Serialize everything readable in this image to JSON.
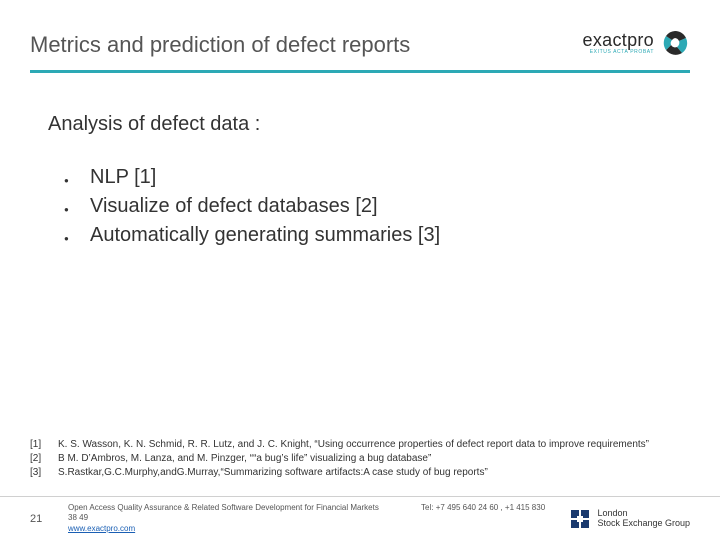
{
  "header": {
    "title": "Metrics and prediction of defect reports",
    "logo": {
      "main": "exactpro",
      "sub": "EXITUS ACTA PROBAT"
    }
  },
  "content": {
    "subtitle": "Analysis of defect data :",
    "bullets": [
      "NLP [1]",
      "Visualize of defect databases [2]",
      "Automatically generating summaries [3]"
    ]
  },
  "refs": [
    {
      "n": "[1]",
      "t": "K. S. Wasson, K. N. Schmid, R. R. Lutz, and J. C. Knight, “Using occurrence properties of defect report data to improve requirements”"
    },
    {
      "n": "[2]",
      "t": "B M. D’Ambros, M. Lanza, and M. Pinzger, ““a bug’s life” visualizing a bug database”"
    },
    {
      "n": "[3]",
      "t": " S.Rastkar,G.C.Murphy,andG.Murray,“Summarizing software artifacts:A case study of bug reports”"
    }
  ],
  "footer": {
    "page": "21",
    "line1": "Open Access Quality Assurance & Related Software Development for Financial Markets",
    "link": "www.exactpro.com",
    "tel": "Tel: +7 495 640 24 60 ,  +1 415 830 38 49",
    "lseg1": "London",
    "lseg2": "Stock Exchange Group"
  }
}
